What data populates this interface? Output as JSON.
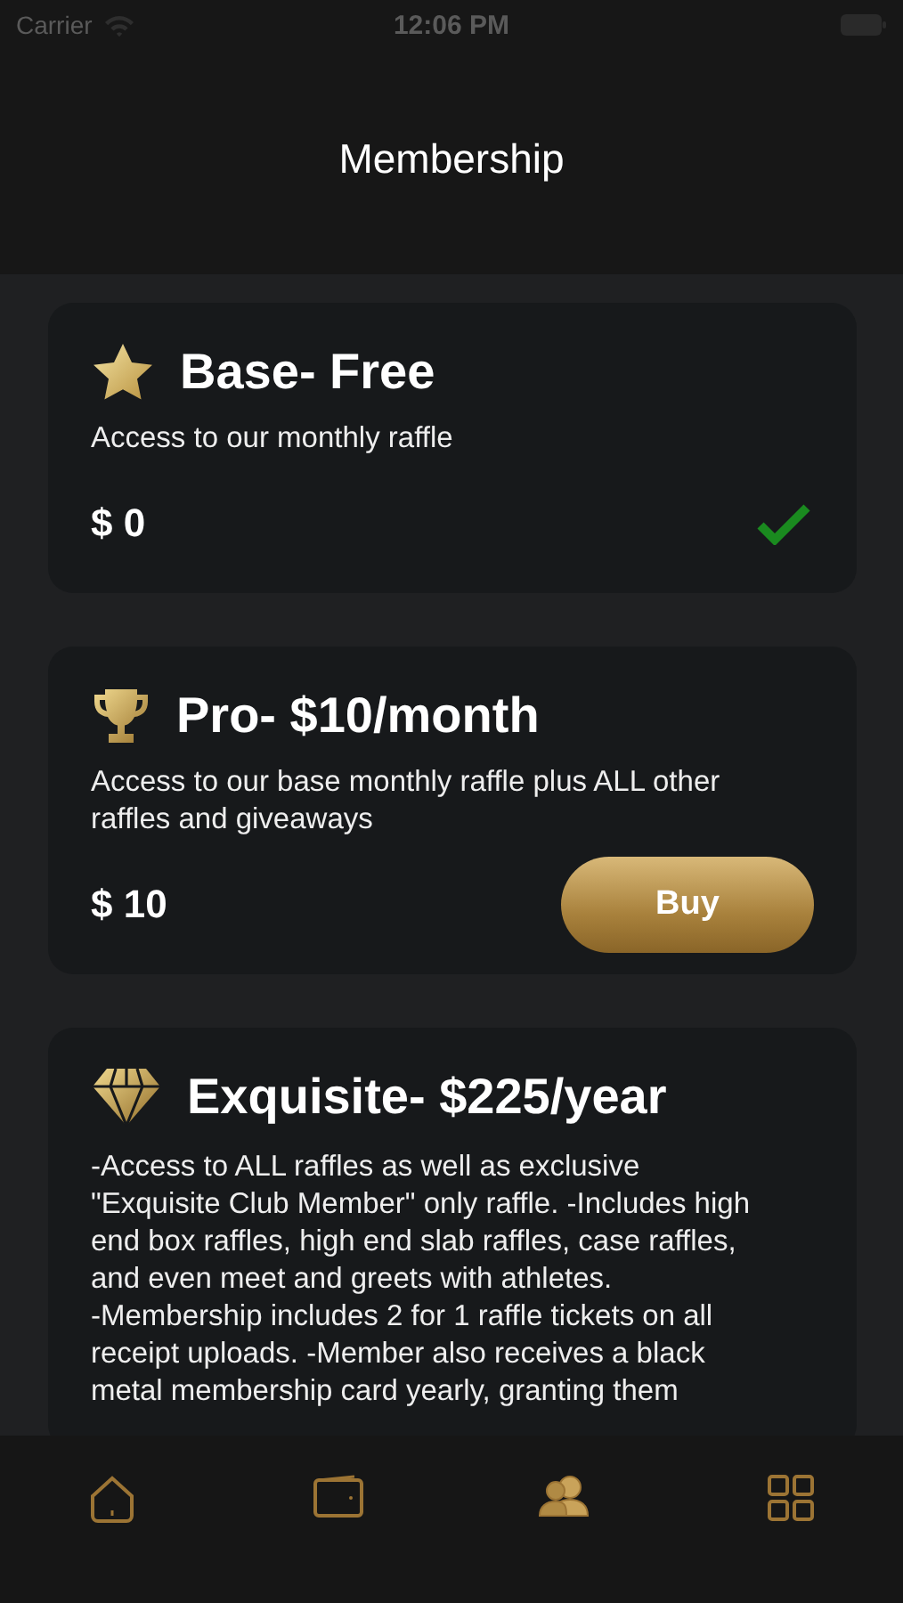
{
  "status_bar": {
    "carrier": "Carrier",
    "time": "12:06 PM"
  },
  "header": {
    "title": "Membership"
  },
  "plans": [
    {
      "kind": "base",
      "title": "Base- Free",
      "description": "Access to our monthly raffle",
      "price": "$ 0",
      "owned": true
    },
    {
      "kind": "pro",
      "title": "Pro- $10/month",
      "description": "Access to our base monthly raffle plus ALL other raffles and giveaways",
      "price": "$ 10",
      "owned": false,
      "button": "Buy"
    },
    {
      "kind": "exquisite",
      "title": "Exquisite- $225/year",
      "description": "-Access to ALL raffles as well as exclusive \"Exquisite Club Member\" only raffle. -Includes high end box raffles, high end slab raffles, case raffles, and even meet and greets with athletes.\n-Membership includes 2 for 1 raffle tickets on all receipt uploads. -Member also receives a black metal membership card yearly, granting them"
    }
  ],
  "tab_bar": [
    {
      "selected": false
    },
    {
      "selected": false
    },
    {
      "selected": true
    },
    {
      "selected": false
    }
  ]
}
